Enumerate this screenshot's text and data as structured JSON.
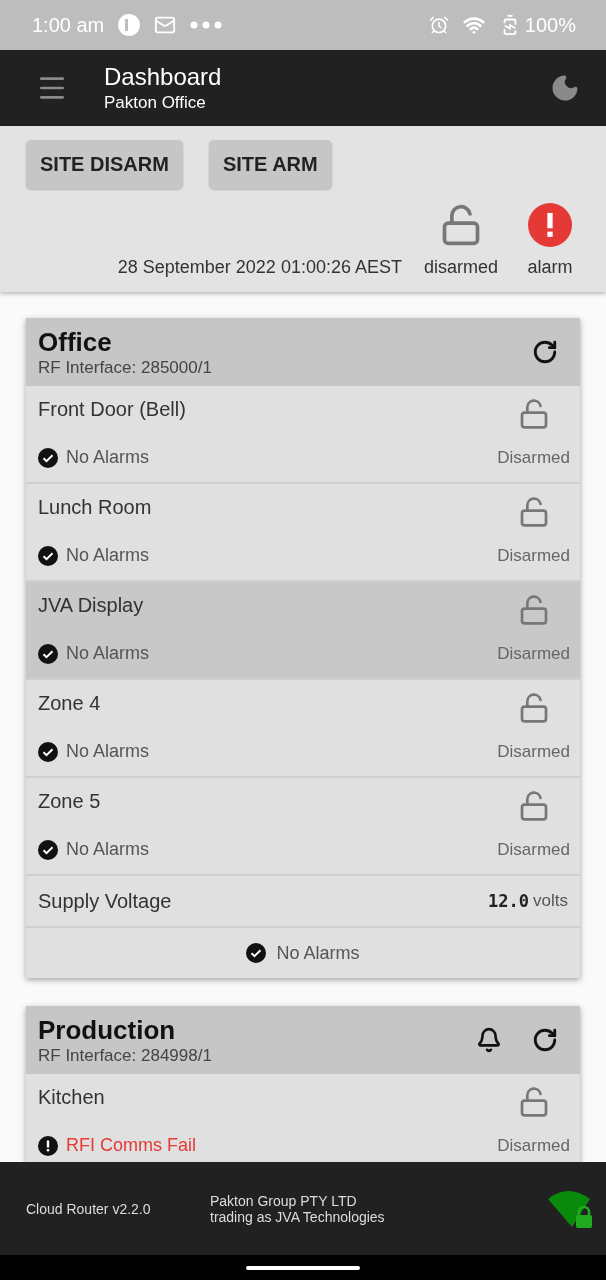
{
  "status_bar": {
    "time": "1:00 am",
    "battery": "100%"
  },
  "app_bar": {
    "title": "Dashboard",
    "subtitle": "Pakton Office"
  },
  "site_buttons": [
    "SITE DISARM",
    "SITE ARM"
  ],
  "site_status": {
    "timestamp": "28 September 2022 01:00:26 AEST",
    "armed": false,
    "arm_label": "disarmed",
    "alarm_active": true,
    "alarm_label": "alarm"
  },
  "areas": [
    {
      "title": "Office",
      "interface": "RF Interface: 285000/1",
      "bell": false,
      "zones": [
        {
          "name": "Front Door (Bell)",
          "status": "No Alarms",
          "alarm": false,
          "armed": false,
          "state": "Disarmed",
          "selected": false
        },
        {
          "name": "Lunch Room",
          "status": "No Alarms",
          "alarm": false,
          "armed": false,
          "state": "Disarmed",
          "selected": false
        },
        {
          "name": "JVA Display",
          "status": "No Alarms",
          "alarm": false,
          "armed": false,
          "state": "Disarmed",
          "selected": true
        },
        {
          "name": "Zone 4",
          "status": "No Alarms",
          "alarm": false,
          "armed": false,
          "state": "Disarmed",
          "selected": false
        },
        {
          "name": "Zone 5",
          "status": "No Alarms",
          "alarm": false,
          "armed": false,
          "state": "Disarmed",
          "selected": false
        }
      ],
      "voltage": {
        "label": "Supply Voltage",
        "value": "12.0",
        "unit": "volts"
      },
      "summary": "No Alarms"
    },
    {
      "title": "Production",
      "interface": "RF Interface: 284998/1",
      "bell": true,
      "zones": [
        {
          "name": "Kitchen",
          "status": "RFI Comms Fail",
          "alarm": true,
          "armed": false,
          "state": "Disarmed",
          "selected": false
        }
      ]
    }
  ],
  "footer": {
    "version": "Cloud Router v2.2.0",
    "company": "Pakton Group PTY LTD",
    "trading": "trading as JVA Technologies"
  }
}
